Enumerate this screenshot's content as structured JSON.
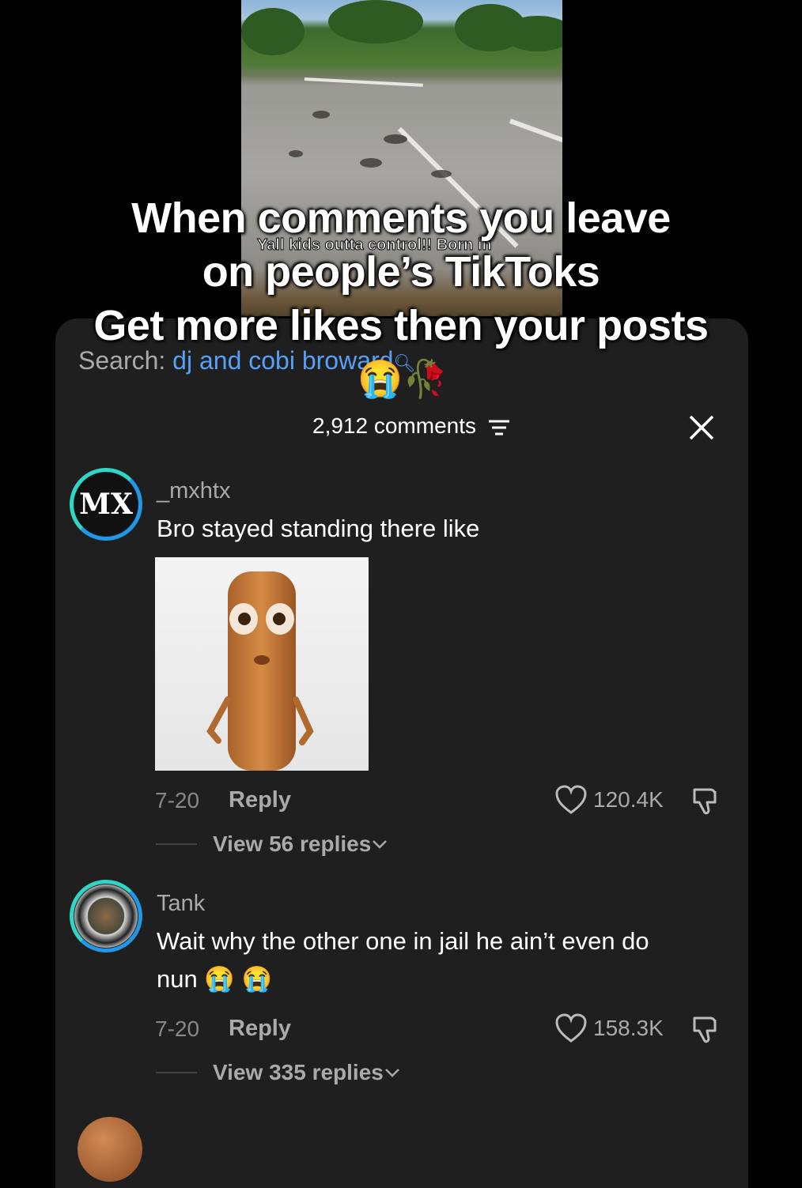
{
  "video": {
    "caption": "Yall kids outta control!! Born in"
  },
  "search": {
    "label": "Search:",
    "query": "dj and cobi broward"
  },
  "overlay": {
    "line1": "When comments you leave",
    "line2": "on people’s TikToks",
    "line3": "Get more likes then your posts",
    "emojis": "😭🥀"
  },
  "header": {
    "comments_count": "2,912 comments"
  },
  "comments": [
    {
      "username": "_mxhtx",
      "avatar_text": "MX",
      "text": "Bro stayed standing there like",
      "date": "7-20",
      "reply_label": "Reply",
      "likes": "120.4K",
      "view_replies": "View 56 replies"
    },
    {
      "username": "Tank",
      "text_line1": "Wait why the other one in jail he ain’t even do",
      "text_line2": "nun 😭 😭",
      "date": "7-20",
      "reply_label": "Reply",
      "likes": "158.3K",
      "view_replies": "View 335 replies"
    }
  ],
  "icons": {
    "filter": "filter-icon",
    "close": "close-icon",
    "heart": "heart-icon",
    "dislike": "dislike-icon",
    "chevron": "chevron-down-icon"
  },
  "colors": {
    "link": "#56a0f5",
    "panel": "#1f1f1f",
    "avatar_ring": "#2fd6c6"
  }
}
